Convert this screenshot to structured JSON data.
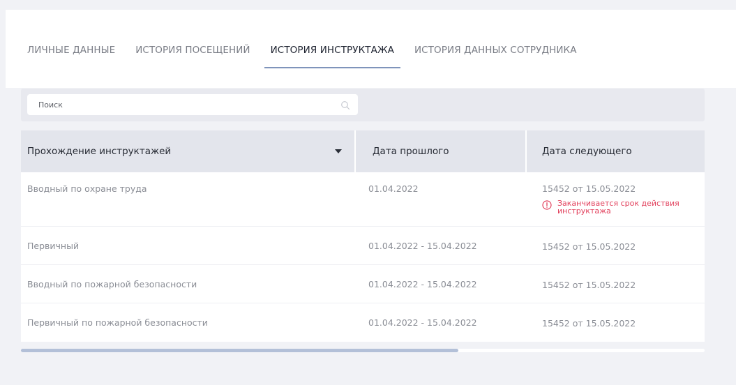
{
  "tabs": [
    {
      "label": "ЛИЧНЫЕ ДАННЫЕ",
      "active": false
    },
    {
      "label": "ИСТОРИЯ ПОСЕЩЕНИЙ",
      "active": false
    },
    {
      "label": "ИСТОРИЯ ИНСТРУКТАЖА",
      "active": true
    },
    {
      "label": "ИСТОРИЯ ДАННЫХ СОТРУДНИКА",
      "active": false
    }
  ],
  "search": {
    "placeholder": "Поиск",
    "value": "",
    "icon": "search-icon"
  },
  "table": {
    "columns": [
      "Прохождение инструктажей",
      "Дата прошлого",
      "Дата следующего"
    ],
    "sort_icon": "caret-down-icon",
    "rows": [
      {
        "name": "Вводный по охране труда",
        "last": "01.04.2022",
        "next": "15452 от 15.05.2022",
        "warning": "Заканчивается срок действия инструктажа"
      },
      {
        "name": "Первичный",
        "last": "01.04.2022 - 15.04.2022",
        "next": "15452 от 15.05.2022"
      },
      {
        "name": "Вводный по пожарной безопасности",
        "last": "01.04.2022 - 15.04.2022",
        "next": "15452 от 15.05.2022"
      },
      {
        "name": "Первичный по пожарной безопасности",
        "last": "01.04.2022 - 15.04.2022",
        "next": "15452 от 15.05.2022"
      }
    ]
  },
  "scrollbar": {
    "position": 0,
    "visible_fraction": 0.64
  },
  "colors": {
    "accent_underline": "#7f94bb",
    "warning": "#e2405c",
    "background": "#f1f2f6",
    "header_bg": "#e3e5ec"
  }
}
